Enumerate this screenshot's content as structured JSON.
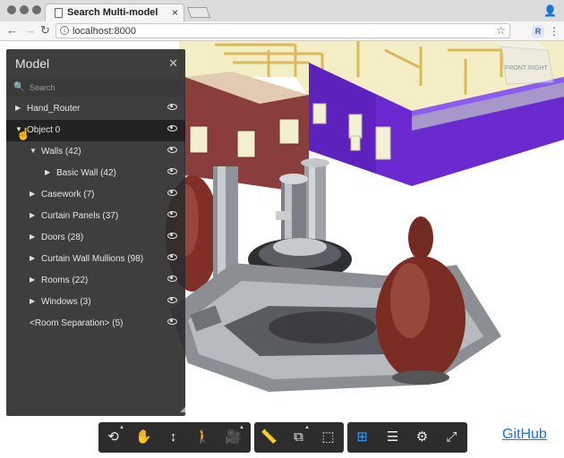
{
  "browser": {
    "tab_title": "Search Multi-model",
    "url": "localhost:8000",
    "ext_r_label": "R"
  },
  "panel": {
    "title": "Model",
    "close_label": "✕",
    "search_placeholder": "Search",
    "items": [
      {
        "label": "Hand_Router"
      },
      {
        "label": "Object 0"
      },
      {
        "label": "Walls (42)"
      },
      {
        "label": "Basic Wall (42)"
      },
      {
        "label": "Casework (7)"
      },
      {
        "label": "Curtain Panels (37)"
      },
      {
        "label": "Doors (28)"
      },
      {
        "label": "Curtain Wall Mullions (98)"
      },
      {
        "label": "Rooms (22)"
      },
      {
        "label": "Windows (3)"
      },
      {
        "label": "<Room Separation> (5)"
      }
    ]
  },
  "viewcube": {
    "front": "FRONT",
    "right": "RIGHT"
  },
  "toolbar": {
    "tools": [
      {
        "icon": "orbit-icon"
      },
      {
        "icon": "pan-hand-icon"
      },
      {
        "icon": "zoom-icon"
      },
      {
        "icon": "first-person-icon"
      },
      {
        "icon": "camera-icon"
      },
      {
        "icon": "measure-icon"
      },
      {
        "icon": "section-icon"
      },
      {
        "icon": "explode-icon"
      },
      {
        "icon": "model-browser-icon"
      },
      {
        "icon": "properties-icon"
      },
      {
        "icon": "settings-gear-icon"
      },
      {
        "icon": "fullscreen-icon"
      }
    ],
    "active_color": "#3d9bff"
  },
  "link": {
    "github_label": "GitHub"
  }
}
